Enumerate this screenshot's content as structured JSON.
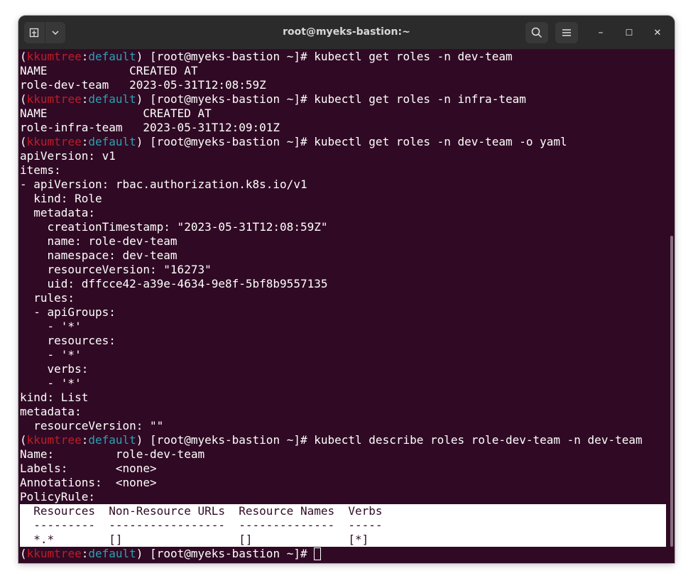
{
  "window": {
    "title": "root@myeks-bastion:~"
  },
  "titlebar": {
    "new_tab_icon": "new-tab-icon",
    "dropdown_icon": "chevron-down-icon",
    "search_icon": "search-icon",
    "menu_icon": "hamburger-menu-icon",
    "minimize_glyph": "–",
    "maximize_glyph": "☐",
    "close_glyph": "✕"
  },
  "colors": {
    "background": "#300a24",
    "context_name": "#c01c28",
    "namespace": "#2aa1b3",
    "text": "#ffffff"
  },
  "prompt": {
    "open": "(",
    "context": "kkumtree",
    "sep": ":",
    "namespace": "default",
    "rest": ") [root@myeks-bastion ~]# "
  },
  "terminal": {
    "lines": [
      {
        "type": "prompt",
        "cmd": "kubectl get roles -n dev-team"
      },
      {
        "type": "text",
        "text": "NAME            CREATED AT"
      },
      {
        "type": "text",
        "text": "role-dev-team   2023-05-31T12:08:59Z"
      },
      {
        "type": "prompt",
        "cmd": "kubectl get roles -n infra-team"
      },
      {
        "type": "text",
        "text": "NAME              CREATED AT"
      },
      {
        "type": "text",
        "text": "role-infra-team   2023-05-31T12:09:01Z"
      },
      {
        "type": "prompt",
        "cmd": "kubectl get roles -n dev-team -o yaml"
      },
      {
        "type": "text",
        "text": "apiVersion: v1"
      },
      {
        "type": "text",
        "text": "items:"
      },
      {
        "type": "text",
        "text": "- apiVersion: rbac.authorization.k8s.io/v1"
      },
      {
        "type": "text",
        "text": "  kind: Role"
      },
      {
        "type": "text",
        "text": "  metadata:"
      },
      {
        "type": "text",
        "text": "    creationTimestamp: \"2023-05-31T12:08:59Z\""
      },
      {
        "type": "text",
        "text": "    name: role-dev-team"
      },
      {
        "type": "text",
        "text": "    namespace: dev-team"
      },
      {
        "type": "text",
        "text": "    resourceVersion: \"16273\""
      },
      {
        "type": "text",
        "text": "    uid: dffcce42-a39e-4634-9e8f-5bf8b9557135"
      },
      {
        "type": "text",
        "text": "  rules:"
      },
      {
        "type": "text",
        "text": "  - apiGroups:"
      },
      {
        "type": "text",
        "text": "    - '*'"
      },
      {
        "type": "text",
        "text": "    resources:"
      },
      {
        "type": "text",
        "text": "    - '*'"
      },
      {
        "type": "text",
        "text": "    verbs:"
      },
      {
        "type": "text",
        "text": "    - '*'"
      },
      {
        "type": "text",
        "text": "kind: List"
      },
      {
        "type": "text",
        "text": "metadata:"
      },
      {
        "type": "text",
        "text": "  resourceVersion: \"\""
      },
      {
        "type": "prompt",
        "cmd": "kubectl describe roles role-dev-team -n dev-team"
      },
      {
        "type": "text",
        "text": "Name:         role-dev-team"
      },
      {
        "type": "text",
        "text": "Labels:       <none>"
      },
      {
        "type": "text",
        "text": "Annotations:  <none>"
      },
      {
        "type": "text",
        "text": "PolicyRule:"
      },
      {
        "type": "highlight",
        "text": "  Resources  Non-Resource URLs  Resource Names  Verbs"
      },
      {
        "type": "highlight",
        "text": "  ---------  -----------------  --------------  -----"
      },
      {
        "type": "highlight",
        "text": "  *.*        []                 []              [*]"
      },
      {
        "type": "prompt",
        "cmd": "",
        "cursor": true
      }
    ]
  }
}
